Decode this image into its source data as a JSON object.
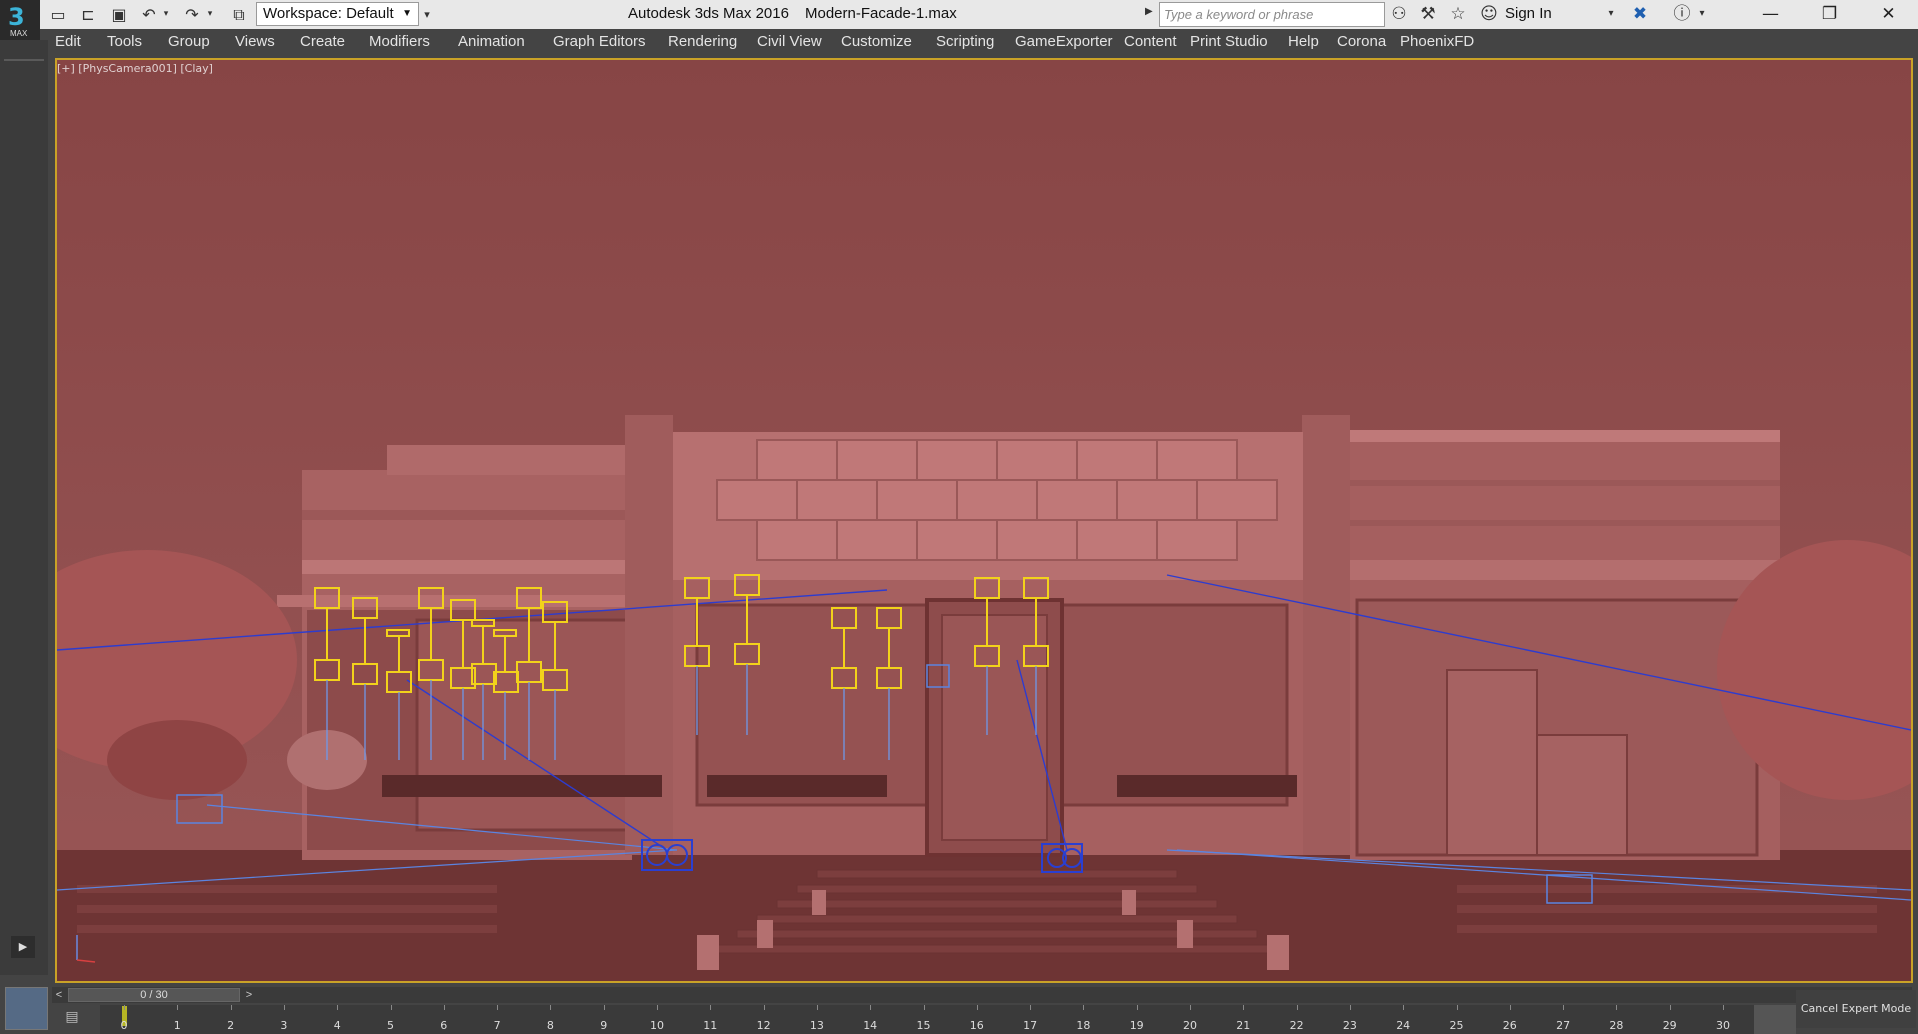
{
  "app": {
    "logo_letter": "3",
    "logo_text": "MAX",
    "title": "Autodesk 3ds Max 2016",
    "file_name": "Modern-Facade-1.max"
  },
  "quick_access": {
    "new_icon": "new-file-icon",
    "open_icon": "open-folder-icon",
    "save_icon": "save-icon",
    "undo_icon": "undo-icon",
    "redo_icon": "redo-icon",
    "project_icon": "project-folder-icon"
  },
  "workspace": {
    "label": "Workspace: Default"
  },
  "search": {
    "placeholder": "Type a keyword or phrase"
  },
  "header_icons": [
    "binoculars-icon",
    "subscription-icon",
    "favorites-star-icon",
    "user-icon"
  ],
  "sign_in": "Sign In",
  "window": {
    "minimize": "—",
    "restore": "❐",
    "close": "✕"
  },
  "menu": [
    "Edit",
    "Tools",
    "Group",
    "Views",
    "Create",
    "Modifiers",
    "Animation",
    "Graph Editors",
    "Rendering",
    "Civil View",
    "Customize",
    "Scripting",
    "GameExporter",
    "Content",
    "Print Studio",
    "Help",
    "Corona",
    "PhoenixFD"
  ],
  "viewport": {
    "label": "[+] [PhysCamera001] [Clay]",
    "background": "#8b4a4a"
  },
  "timeline": {
    "frame_display": "0 / 30",
    "current_frame": 0,
    "ticks": [
      "0",
      "1",
      "2",
      "3",
      "4",
      "5",
      "6",
      "7",
      "8",
      "9",
      "10",
      "11",
      "12",
      "13",
      "14",
      "15",
      "16",
      "17",
      "18",
      "19",
      "20",
      "21",
      "22",
      "23",
      "24",
      "25",
      "26",
      "27",
      "28",
      "29",
      "30"
    ]
  },
  "status": {
    "cancel_expert": "Cancel Expert Mode"
  },
  "colors": {
    "viewport_border": "#c9a227",
    "light_gizmo": "#f2d21b",
    "camera_gizmo": "#2a3fd1"
  }
}
